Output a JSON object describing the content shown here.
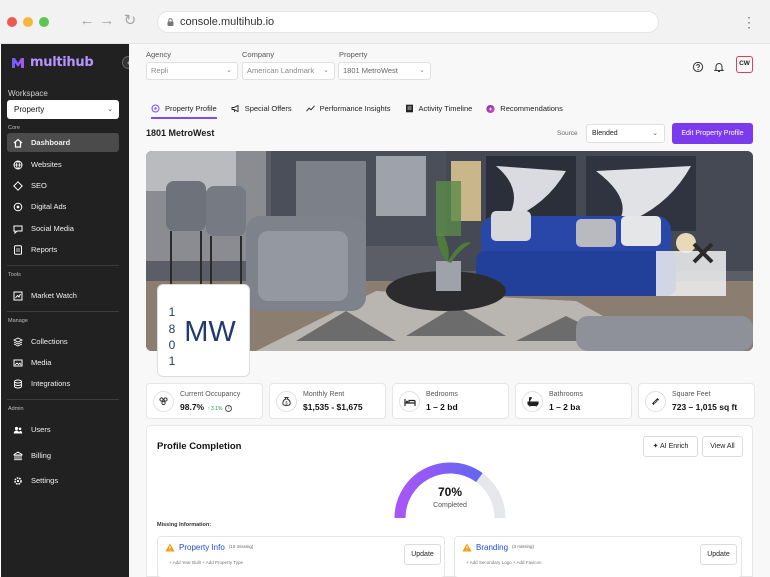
{
  "browser": {
    "url": "console.multihub.io"
  },
  "sidebar": {
    "logo_text": "multihub",
    "workspace_label": "Workspace",
    "workspace_value": "Property",
    "sections": {
      "core": "Core",
      "tools": "Tools",
      "manage": "Manage",
      "admin": "Admin"
    },
    "items": {
      "dashboard": "Dashboard",
      "websites": "Websites",
      "seo": "SEO",
      "digital_ads": "Digital Ads",
      "social_media": "Social Media",
      "reports": "Reports",
      "market_watch": "Market Watch",
      "collections": "Collections",
      "media": "Media",
      "integrations": "Integrations",
      "users": "Users",
      "billing": "Billing",
      "settings": "Settings"
    }
  },
  "header": {
    "agency_label": "Agency",
    "agency_value": "Repli",
    "company_label": "Company",
    "company_value": "American Landmark",
    "property_label": "Property",
    "property_value": "1801 MetroWest",
    "avatar": "CW"
  },
  "tabs": {
    "profile": "Property Profile",
    "offers": "Special Offers",
    "insights": "Performance Insights",
    "timeline": "Activity Timeline",
    "recs": "Recommendations"
  },
  "property": {
    "name": "1801 MetroWest",
    "source_label": "Source",
    "source_value": "Blended",
    "edit_button": "Edit Property Profile",
    "logo_number": "1801",
    "logo_letters": "MW"
  },
  "stats": {
    "occupancy": {
      "label": "Current Occupancy",
      "value": "98.7%",
      "trend": "↑ 3.1%"
    },
    "rent": {
      "label": "Monthly Rent",
      "value": "$1,535 - $1,675"
    },
    "bedrooms": {
      "label": "Bedrooms",
      "value": "1 – 2 bd"
    },
    "bathrooms": {
      "label": "Bathrooms",
      "value": "1 – 2 ba"
    },
    "sqft": {
      "label": "Square Feet",
      "value": "723 – 1,015 sq ft"
    }
  },
  "completion": {
    "title": "Profile Completion",
    "ai_button": "AI Enrich",
    "view_all": "View All",
    "percent": 70,
    "percent_text": "70%",
    "status": "Completed",
    "missing_label": "Missing Information:",
    "cards": [
      {
        "title": "Property Info",
        "count": "(10 missing)",
        "sub": "+ Add Year Built   + Add Property Type",
        "button": "Update"
      },
      {
        "title": "Branding",
        "count": "(3 missing)",
        "sub": "+ Add Secondary Logo   + Add Favicon",
        "button": "Update"
      }
    ]
  },
  "colors": {
    "accent": "#7c3aed",
    "sidebar_bg": "#212121",
    "link": "#1d4ed8",
    "warning": "#f59e0b"
  }
}
